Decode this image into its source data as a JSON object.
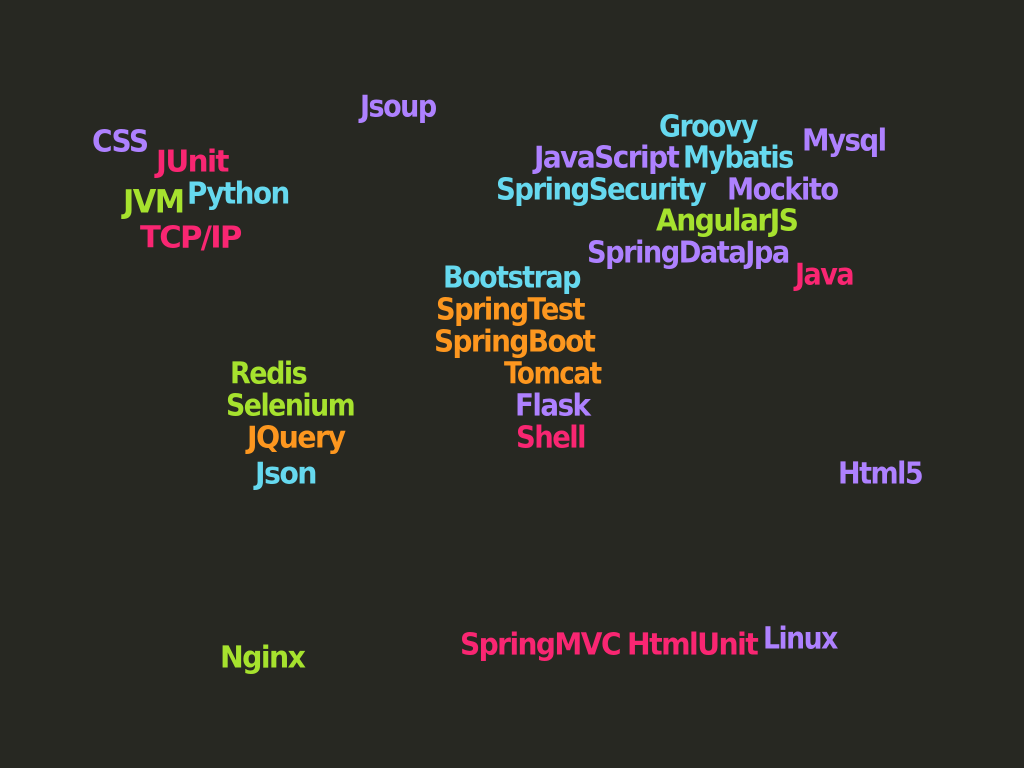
{
  "palette": {
    "purple": "#AE81FF",
    "pink": "#F92672",
    "green": "#A6E22E",
    "cyan": "#66D9EF",
    "orange": "#FD971F"
  },
  "words": [
    {
      "text": "Jsoup",
      "color": "purple"
    },
    {
      "text": "CSS",
      "color": "purple"
    },
    {
      "text": "JUnit",
      "color": "pink"
    },
    {
      "text": "JVM",
      "color": "green"
    },
    {
      "text": "Python",
      "color": "cyan"
    },
    {
      "text": "TCP/IP",
      "color": "pink"
    },
    {
      "text": "Groovy",
      "color": "cyan"
    },
    {
      "text": "Mysql",
      "color": "purple"
    },
    {
      "text": "JavaScript",
      "color": "purple"
    },
    {
      "text": "Mybatis",
      "color": "cyan"
    },
    {
      "text": "SpringSecurity",
      "color": "cyan"
    },
    {
      "text": "Mockito",
      "color": "purple"
    },
    {
      "text": "AngularJS",
      "color": "green"
    },
    {
      "text": "SpringDataJpa",
      "color": "purple"
    },
    {
      "text": "Java",
      "color": "pink"
    },
    {
      "text": "Bootstrap",
      "color": "cyan"
    },
    {
      "text": "SpringTest",
      "color": "orange"
    },
    {
      "text": "SpringBoot",
      "color": "orange"
    },
    {
      "text": "Tomcat",
      "color": "orange"
    },
    {
      "text": "Flask",
      "color": "purple"
    },
    {
      "text": "Shell",
      "color": "pink"
    },
    {
      "text": "Redis",
      "color": "green"
    },
    {
      "text": "Selenium",
      "color": "green"
    },
    {
      "text": "JQuery",
      "color": "orange"
    },
    {
      "text": "Json",
      "color": "cyan"
    },
    {
      "text": "Html5",
      "color": "purple"
    },
    {
      "text": "Nginx",
      "color": "green"
    },
    {
      "text": "SpringMVC",
      "color": "pink"
    },
    {
      "text": "HtmlUnit",
      "color": "pink"
    },
    {
      "text": "Linux",
      "color": "purple"
    }
  ]
}
